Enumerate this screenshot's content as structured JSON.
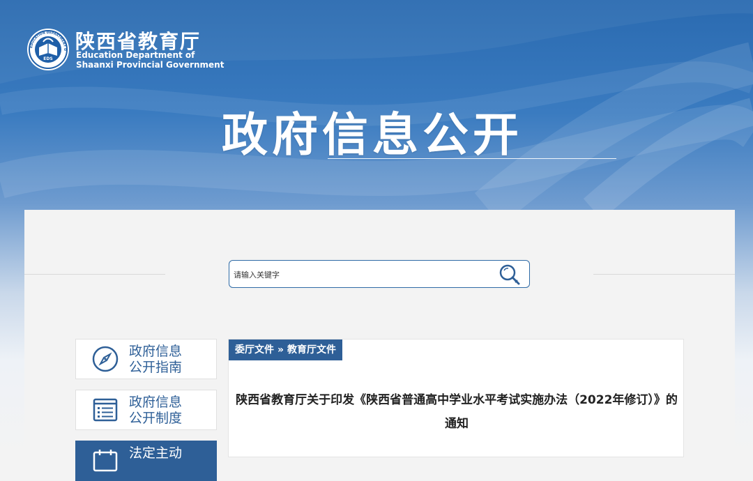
{
  "header": {
    "site_name_cn": "陕西省教育厅",
    "site_name_en_line1": "Education Department of",
    "site_name_en_line2": "Shaanxi Provincial Government",
    "logo_ring_text": "EDUCATION DEPARTMENT OF SHAANXI",
    "logo_badge": "EDS",
    "hero_title": "政府信息公开"
  },
  "search": {
    "placeholder": "请输入关键字",
    "value": ""
  },
  "sidebar": {
    "items": [
      {
        "line1": "政府信息",
        "line2": "公开指南",
        "icon": "compass-icon",
        "active": false
      },
      {
        "line1": "政府信息",
        "line2": "公开制度",
        "icon": "document-list-icon",
        "active": false
      },
      {
        "line1": "法定主动",
        "line2": "",
        "icon": "calendar-icon",
        "active": true
      }
    ]
  },
  "content": {
    "breadcrumb": {
      "level1": "委厅文件",
      "separator": "»",
      "level2": "教育厅文件"
    },
    "article_title": "陕西省教育厅关于印发《陕西省普通高中学业水平考试实施办法（2022年修订）》的通知"
  },
  "colors": {
    "brand_blue": "#2e5f97",
    "search_border": "#2e6aa6",
    "banner_top": "#2a6ab0"
  }
}
